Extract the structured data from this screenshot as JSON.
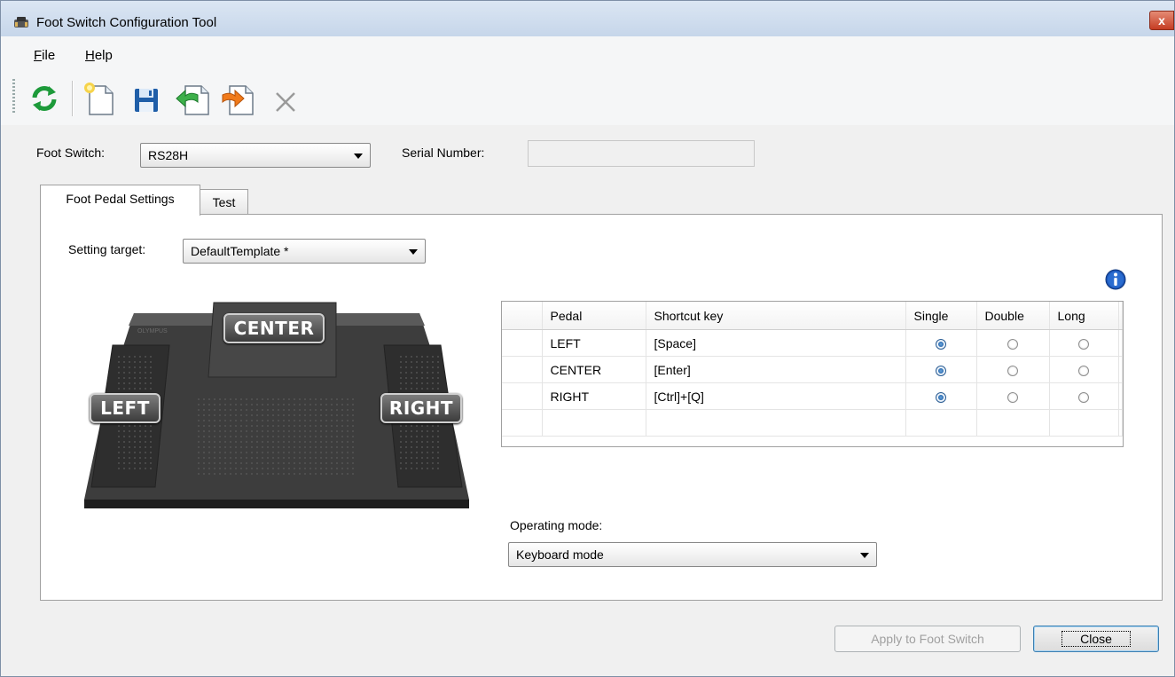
{
  "window": {
    "title": "Foot Switch Configuration Tool",
    "close_glyph": "x"
  },
  "menu": {
    "file": "File",
    "file_key": "F",
    "file_rest": "ile",
    "help_key": "H",
    "help_rest": "elp"
  },
  "toolbar": {
    "icons": [
      "refresh-icon",
      "new-icon",
      "save-icon",
      "import-icon",
      "export-icon",
      "delete-icon"
    ]
  },
  "foot_switch": {
    "label": "Foot Switch:",
    "value": "RS28H"
  },
  "serial": {
    "label": "Serial Number:",
    "value": ""
  },
  "tabs": [
    {
      "label": "Foot Pedal Settings",
      "active": true
    },
    {
      "label": "Test",
      "active": false
    }
  ],
  "setting_target": {
    "label": "Setting target:",
    "value": "DefaultTemplate *"
  },
  "pedal_image": {
    "left": "LEFT",
    "center": "CENTER",
    "right": "RIGHT"
  },
  "grid": {
    "headers": {
      "pedal": "Pedal",
      "shortcut": "Shortcut key",
      "single": "Single",
      "double": "Double",
      "long": "Long"
    },
    "rows": [
      {
        "pedal": "LEFT",
        "shortcut": "[Space]",
        "selected": "single"
      },
      {
        "pedal": "CENTER",
        "shortcut": "[Enter]",
        "selected": "single"
      },
      {
        "pedal": "RIGHT",
        "shortcut": "[Ctrl]+[Q]",
        "selected": "single"
      }
    ]
  },
  "operating_mode": {
    "label": "Operating mode:",
    "value": "Keyboard mode"
  },
  "buttons": {
    "apply": "Apply to Foot Switch",
    "close": "Close"
  },
  "colors": {
    "accent": "#2a6cc0",
    "title_bar": "#c9d8ec",
    "close_red": "#c53c23"
  }
}
